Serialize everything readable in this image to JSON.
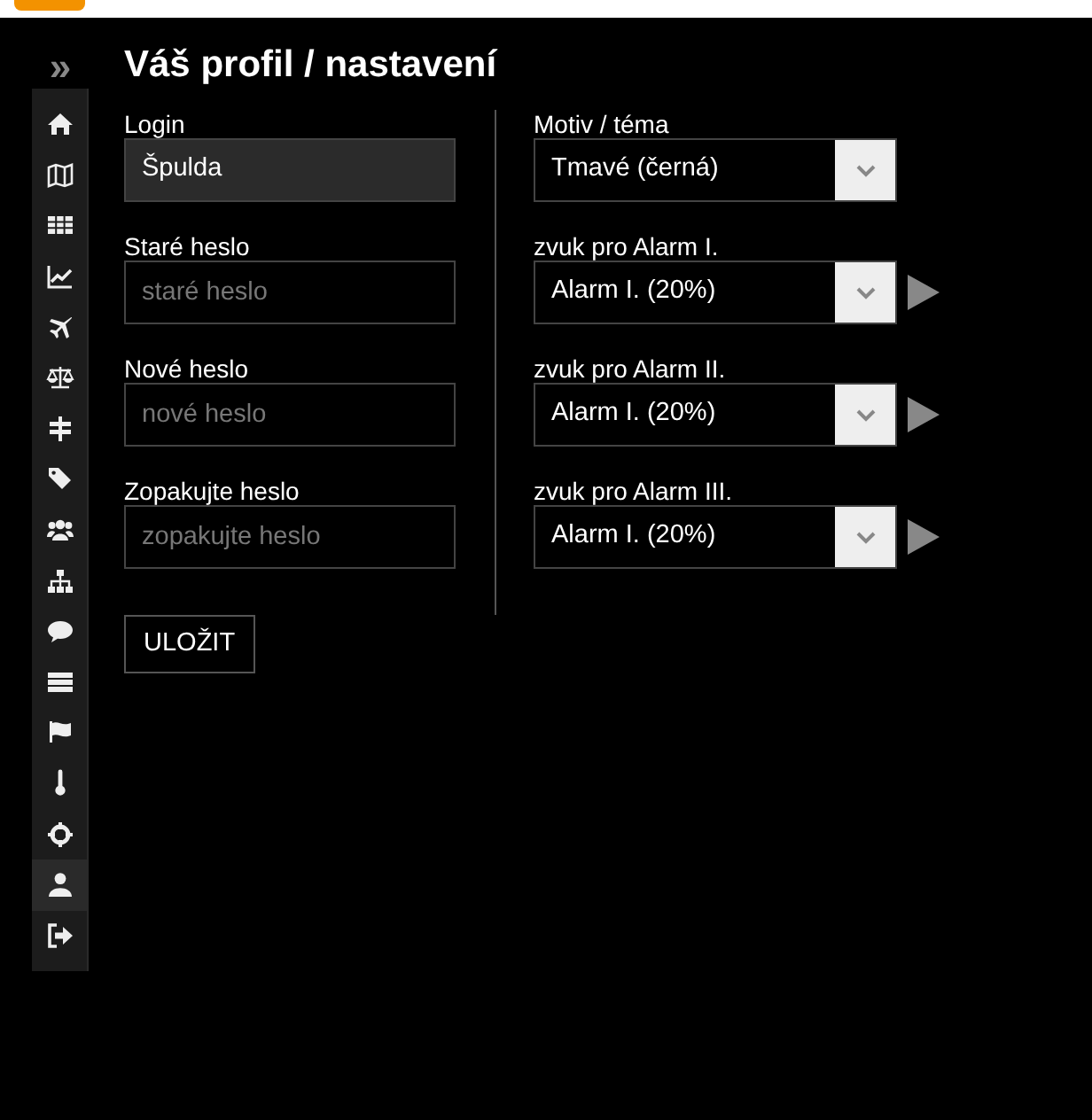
{
  "sidebar": {
    "toggle": "»",
    "items": [
      {
        "selected": false
      },
      {
        "selected": false
      },
      {
        "selected": false
      },
      {
        "selected": false
      },
      {
        "selected": false
      },
      {
        "selected": false
      },
      {
        "selected": false
      },
      {
        "selected": false
      },
      {
        "selected": false
      },
      {
        "selected": false
      },
      {
        "selected": false
      },
      {
        "selected": false
      },
      {
        "selected": false
      },
      {
        "selected": false
      },
      {
        "selected": false
      },
      {
        "selected": true
      },
      {
        "selected": false
      }
    ]
  },
  "title": "Váš profil / nastavení",
  "left_fields": [
    {
      "label": "Login",
      "value": "Špulda",
      "readonly": true
    },
    {
      "label": "Staré heslo",
      "placeholder": "staré heslo"
    },
    {
      "label": "Nové heslo",
      "placeholder": "nové heslo"
    },
    {
      "label": "Zopakujte heslo",
      "placeholder": "zopakujte heslo"
    }
  ],
  "save_button": "ULOŽIT",
  "right_fields": [
    {
      "label": "Motiv / téma",
      "value": "Tmavé (černá)",
      "kind": "select"
    },
    {
      "label": "zvuk pro Alarm I.",
      "value": "Alarm I. (20%)",
      "kind": "sound"
    },
    {
      "label": "zvuk pro Alarm II.",
      "value": "Alarm I. (20%)",
      "kind": "sound"
    },
    {
      "label": "zvuk pro Alarm III.",
      "value": "Alarm I. (20%)",
      "kind": "sound"
    }
  ]
}
